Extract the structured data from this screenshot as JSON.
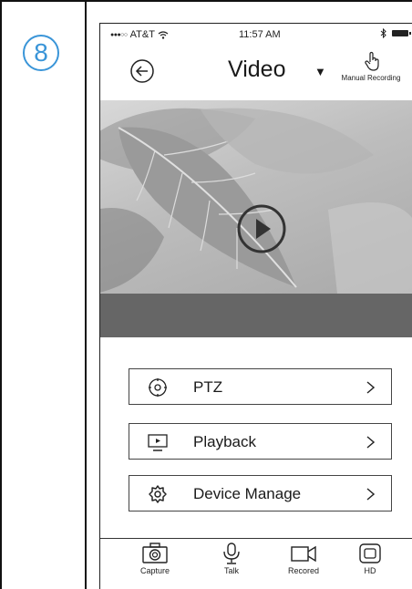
{
  "step": {
    "number": "8",
    "color": "#3a95d8"
  },
  "status_bar": {
    "carrier": "AT&T",
    "signal_dots": "●●●○○",
    "time": "11:57 AM",
    "icons": [
      "wifi-icon",
      "bluetooth-icon",
      "battery-icon"
    ]
  },
  "nav": {
    "back_icon": "back-arrow-icon",
    "title": "Video",
    "dropdown_icon": "caret-down-icon",
    "manual_recording_label": "Manual Recording",
    "manual_recording_icon": "hand-pointer-icon"
  },
  "video": {
    "play_icon": "play-icon",
    "thumbnail": "leaf-photo"
  },
  "menu": [
    {
      "label": "PTZ",
      "icon": "ptz-crosshair-icon"
    },
    {
      "label": "Playback",
      "icon": "playback-screen-icon"
    },
    {
      "label": "Device Manage",
      "icon": "gear-icon"
    }
  ],
  "tabs": [
    {
      "label": "Capture",
      "icon": "camera-icon"
    },
    {
      "label": "Talk",
      "icon": "microphone-icon"
    },
    {
      "label": "Recored",
      "icon": "video-camera-icon"
    },
    {
      "label": "HD",
      "icon": "hd-icon"
    }
  ]
}
